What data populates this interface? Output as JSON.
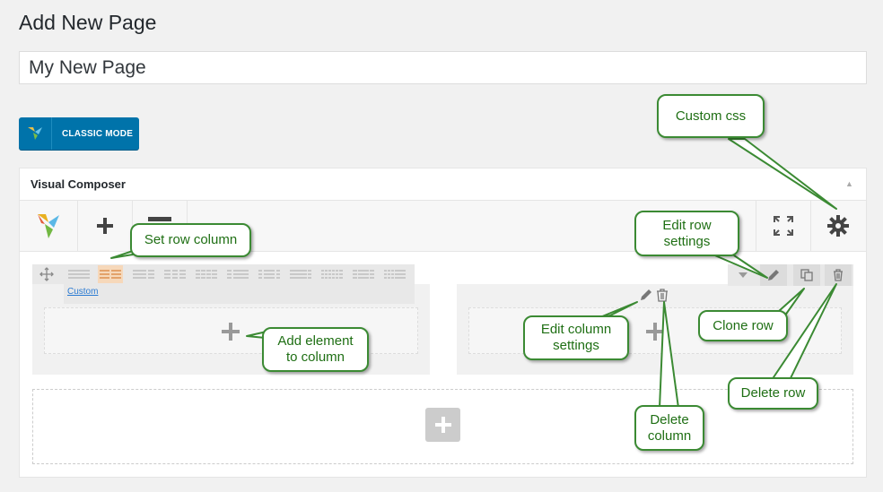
{
  "page": {
    "heading": "Add New Page"
  },
  "title_field": {
    "value": "My New Page"
  },
  "classic_mode": {
    "label": "CLASSIC MODE"
  },
  "composer": {
    "title": "Visual Composer",
    "toggle_icon": "triangle-up-icon",
    "toolbar": {
      "logo_icon": "vc-logo-icon",
      "add_icon": "plus-icon",
      "layout_icon": "row-layout-icon",
      "fullscreen_icon": "fullscreen-icon",
      "settings_icon": "gear-icon"
    },
    "row": {
      "move_icon": "move-icon",
      "layout_custom_label": "Custom",
      "layout_options": [
        "1/1",
        "1/2+1/2",
        "2/3+1/3",
        "1/3+1/3+1/3",
        "1/4x4",
        "1/4+3/4",
        "1/6+4/6+1/6",
        "5/6+1/6",
        "1/6x6",
        "1/4+1/2+1/4",
        "1/6+1/6+1/6+1/2"
      ],
      "selected_layout": "1/2+1/2",
      "controls": [
        "toggle",
        "edit-row",
        "clone-row",
        "delete-row"
      ]
    }
  },
  "callouts": {
    "custom_css": "Custom css",
    "edit_row": "Edit row\nsettings",
    "set_row_column": "Set row column",
    "add_element": "Add element\nto  column",
    "edit_column": "Edit column\nsettings",
    "clone_row": "Clone row",
    "delete_row": "Delete row",
    "delete_column": "Delete\ncolumn"
  },
  "colors": {
    "accent": "#0073aa",
    "callout_border": "#3b8a33",
    "callout_text": "#1f6f14"
  }
}
